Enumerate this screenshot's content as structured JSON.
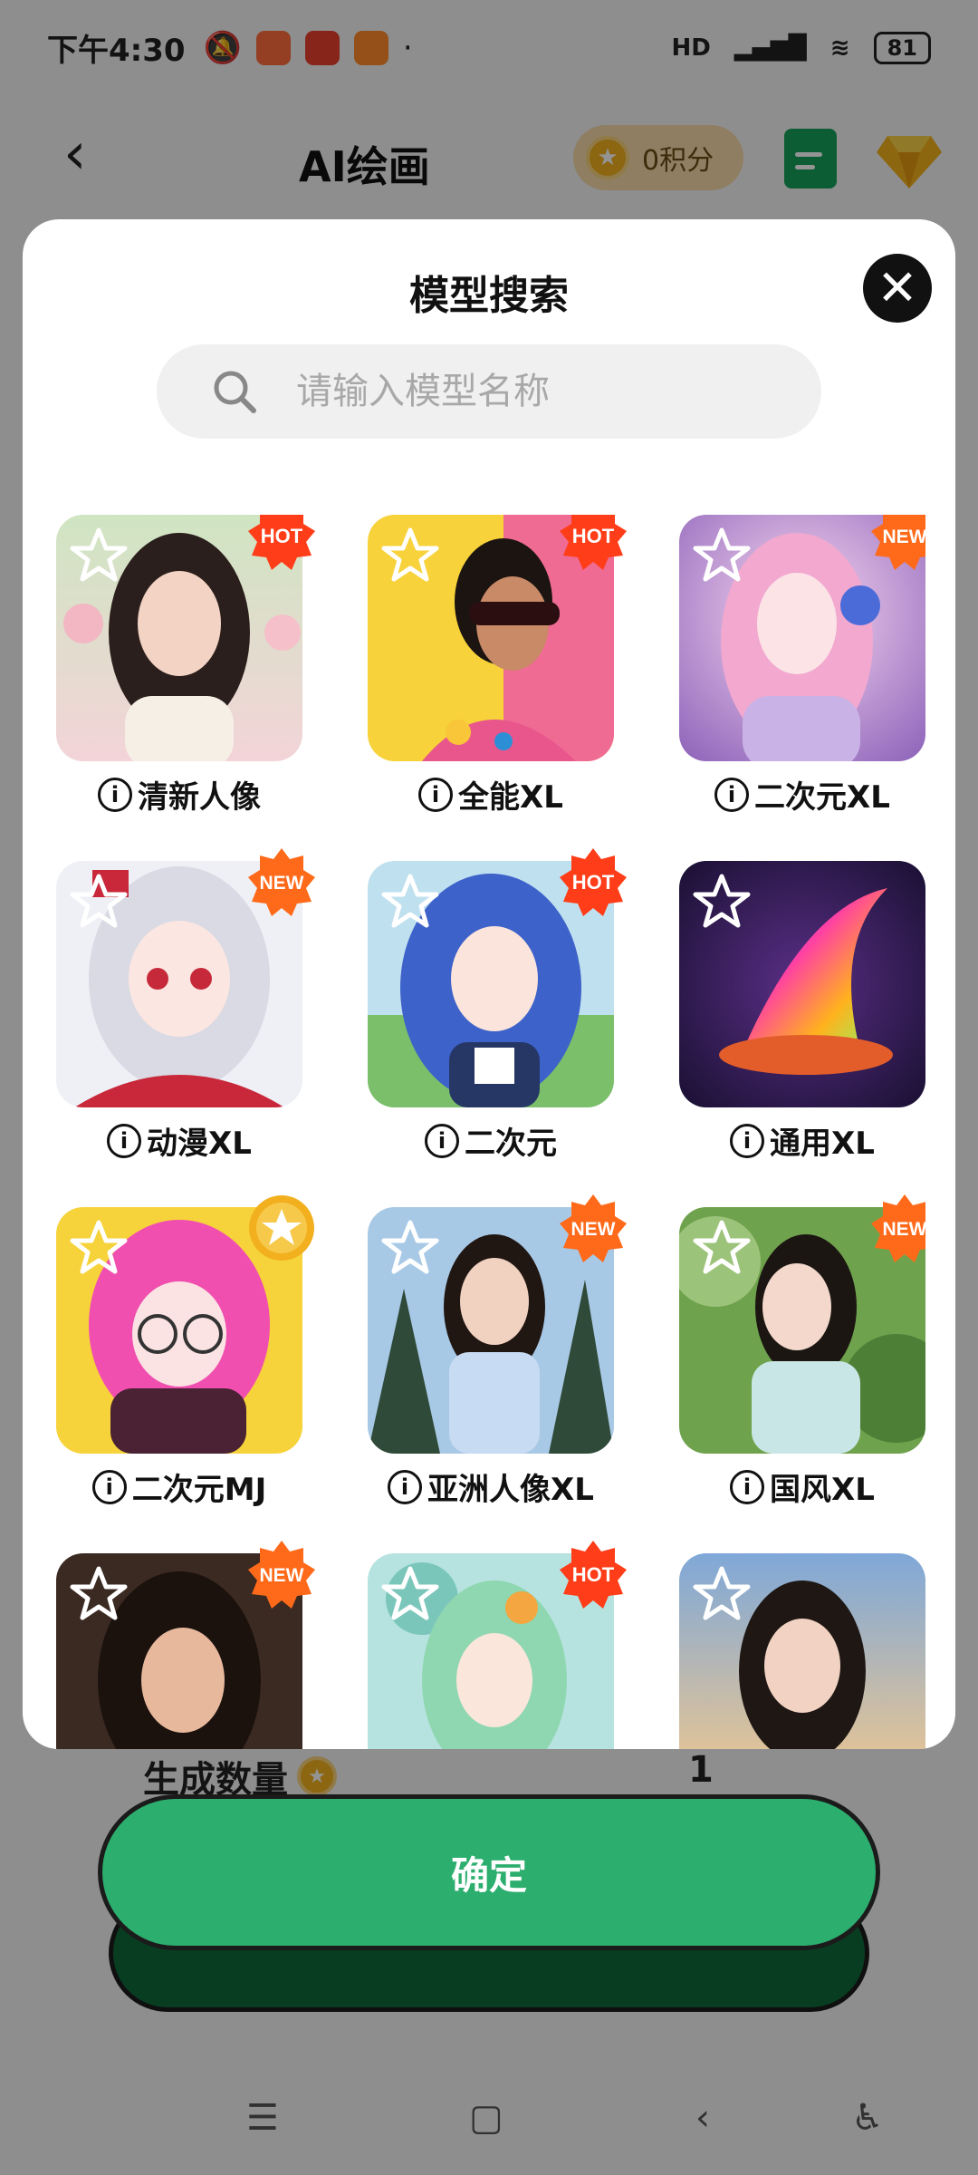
{
  "status_bar": {
    "time": "下午4:30",
    "battery": "81",
    "network": "HD"
  },
  "app_bar": {
    "title": "AI绘画",
    "points": "0积分"
  },
  "background": {
    "generate_count_label": "生成数量",
    "generate_count_value": "1"
  },
  "modal": {
    "title": "模型搜索",
    "search_placeholder": "请输入模型名称",
    "models": [
      {
        "label": "清新人像",
        "badge": "HOT"
      },
      {
        "label": "全能XL",
        "badge": "HOT"
      },
      {
        "label": "二次元XL",
        "badge": "NEW"
      },
      {
        "label": "动漫XL",
        "badge": "NEW"
      },
      {
        "label": "二次元",
        "badge": "HOT"
      },
      {
        "label": "通用XL",
        "badge": ""
      },
      {
        "label": "二次元MJ",
        "badge": "star"
      },
      {
        "label": "亚洲人像XL",
        "badge": "NEW"
      },
      {
        "label": "国风XL",
        "badge": "NEW"
      },
      {
        "label": "",
        "badge": "NEW"
      },
      {
        "label": "",
        "badge": "HOT"
      },
      {
        "label": "",
        "badge": ""
      }
    ]
  },
  "confirm_label": "确定",
  "colors": {
    "accent_green": "#2cae6e",
    "hot_badge": "#ff4a17",
    "new_badge": "#ff6a1a"
  }
}
